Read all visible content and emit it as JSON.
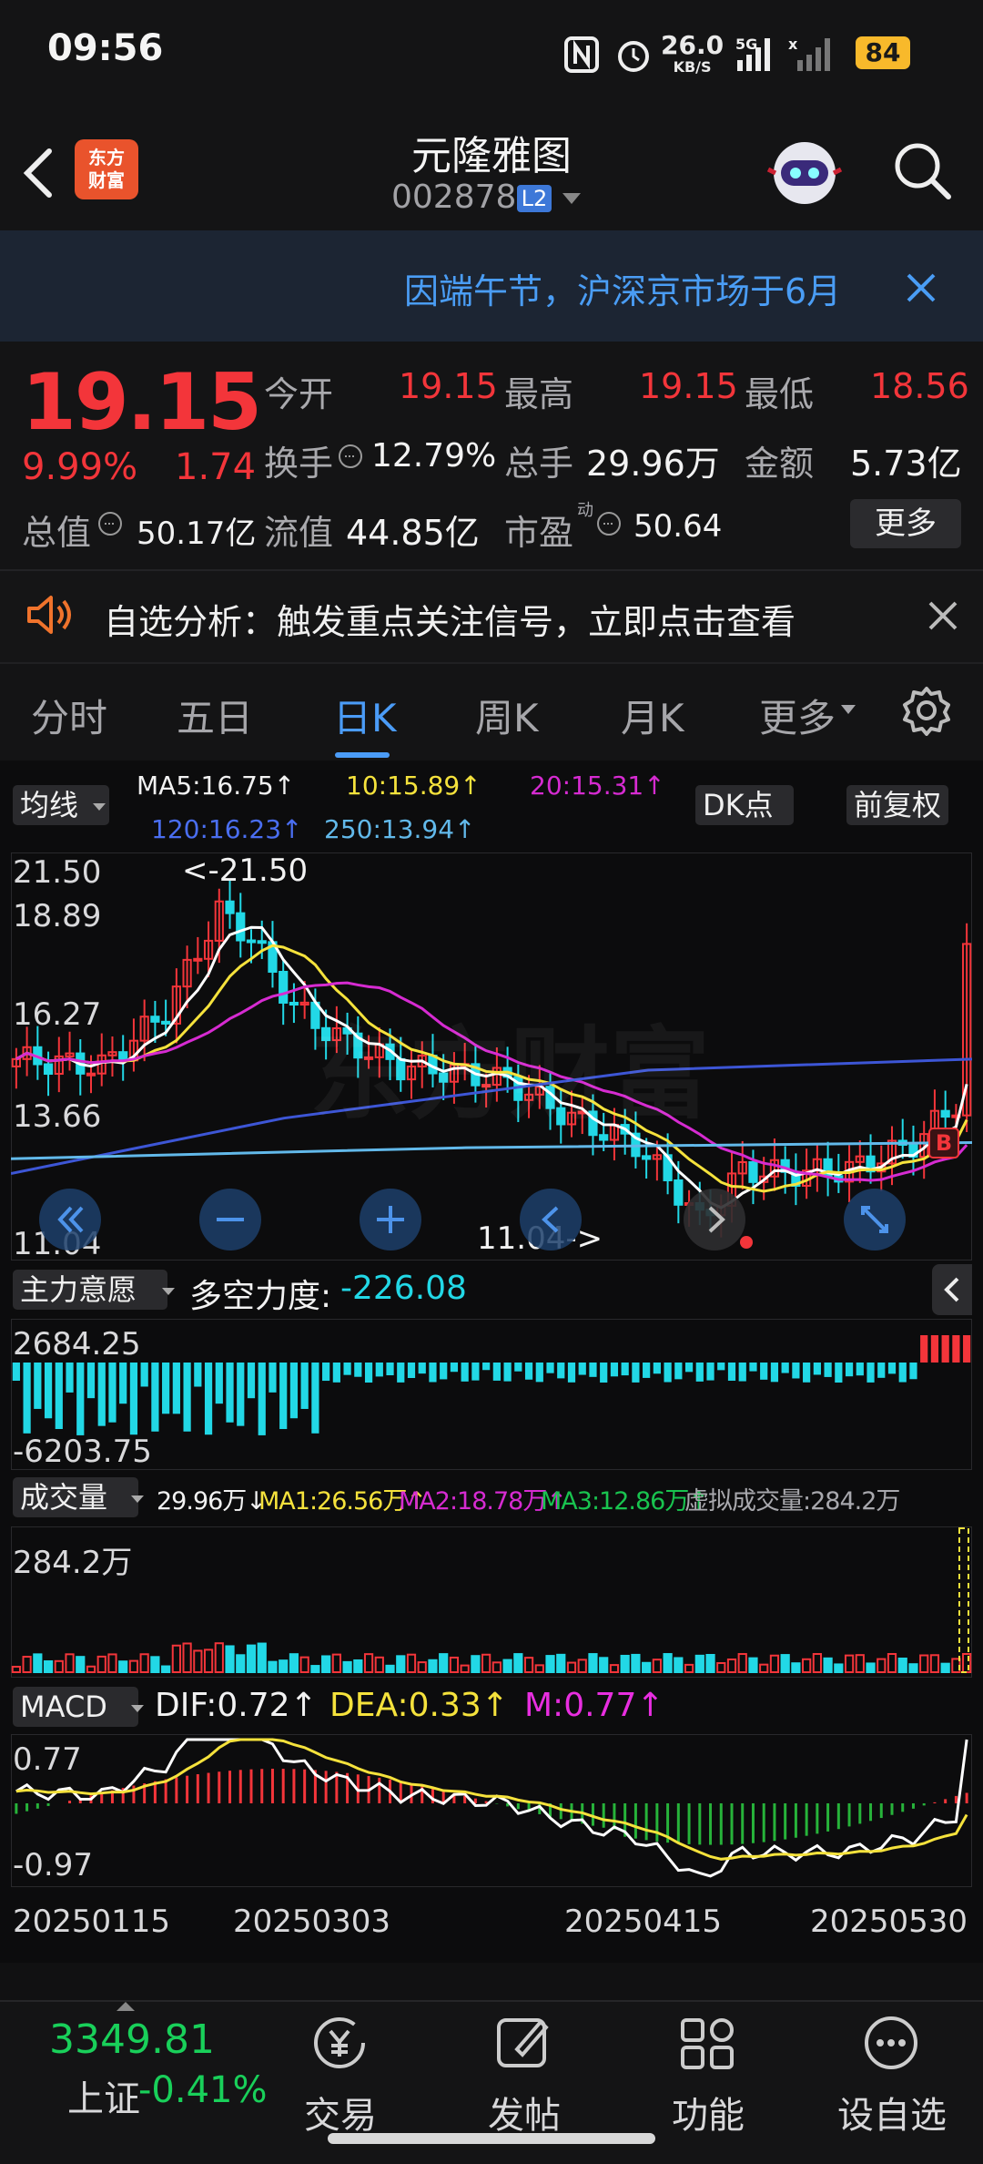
{
  "status": {
    "time": "09:56",
    "net_speed": "26.0",
    "net_unit": "KB/S",
    "battery": "84"
  },
  "header": {
    "title": "元隆雅图",
    "code": "002878",
    "level": "L2",
    "logo_line1": "东方",
    "logo_line2": "财富"
  },
  "notice": {
    "text": "因端午节，沪深京市场于6月"
  },
  "quote": {
    "price": "19.15",
    "change_pct": "9.99%",
    "change": "1.74",
    "open_label": "今开",
    "open": "19.15",
    "high_label": "最高",
    "high": "19.15",
    "low_label": "最低",
    "low": "18.56",
    "turnover_label": "换手",
    "turnover": "12.79%",
    "volume_label": "总手",
    "volume": "29.96万",
    "amount_label": "金额",
    "amount": "5.73亿",
    "mktcap_label": "总值",
    "mktcap": "50.17亿",
    "float_label": "流值",
    "float": "44.85亿",
    "pe_label": "市盈",
    "pe_sup": "动",
    "pe": "50.64",
    "more": "更多"
  },
  "signal": {
    "text": "自选分析：触发重点关注信号，立即点击查看"
  },
  "tabs": [
    "分时",
    "五日",
    "日K",
    "周K",
    "月K",
    "更多"
  ],
  "chart": {
    "ma_button": "均线",
    "ma5": "MA5:16.75↑",
    "ma10": "10:15.89↑",
    "ma20": "20:15.31↑",
    "ma120": "120:16.23↑",
    "ma250": "250:13.94↑",
    "dk_button": "DK点",
    "adjust_button": "前复权",
    "y_high": "21.50",
    "y2": "18.89",
    "y3": "16.27",
    "y4": "13.66",
    "y_low": "11.04",
    "high_marker": "<-21.50",
    "low_marker": "11.04->",
    "b_marker": "B",
    "force_button": "主力意愿",
    "force_label": "多空力度:",
    "force_value": "-226.08",
    "force_max": "2684.25",
    "force_min": "-6203.75",
    "vol_button": "成交量",
    "vol_now": "29.96万↓",
    "vol_ma1": "MA1:26.56万↑",
    "vol_ma2": "MA2:18.78万↑",
    "vol_ma3": "MA3:12.86万↑",
    "virtual_vol": "虚拟成交量:284.2万",
    "vol_max": "284.2万",
    "macd_button": "MACD",
    "dif": "DIF:0.72↑",
    "dea": "DEA:0.33↑",
    "m": "M:0.77↑",
    "macd_max": "0.77",
    "macd_min": "-0.97",
    "dates": [
      "20250115",
      "20250303",
      "20250415",
      "20250530"
    ],
    "colors": {
      "up": "#f3353a",
      "down": "#22d8e6",
      "ma5": "#ffffff",
      "ma10": "#f5e23c",
      "ma20": "#d62bd1",
      "ma120": "#3d56d6",
      "ma250": "#62b9ea"
    }
  },
  "bottom": {
    "index_value": "3349.81",
    "index_name": "上证",
    "index_change": "-0.41%",
    "nav": [
      "交易",
      "发帖",
      "功能",
      "设自选"
    ]
  }
}
